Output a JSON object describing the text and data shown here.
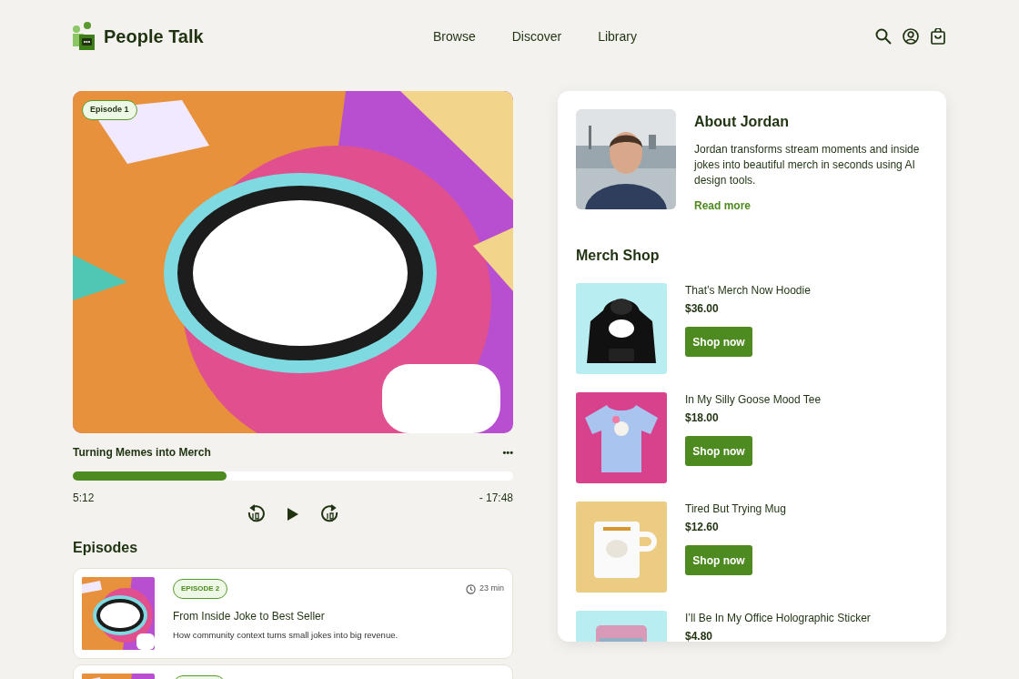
{
  "header": {
    "brand": "People Talk",
    "nav": [
      {
        "label": "Browse"
      },
      {
        "label": "Discover"
      },
      {
        "label": "Library"
      }
    ]
  },
  "player": {
    "badge": "Episode 1",
    "title": "Turning Memes into Merch",
    "menu": "•••",
    "level": 0.35,
    "elapsed": "5:12",
    "remaining": "- 17:48"
  },
  "episodes": {
    "heading": "Episodes",
    "items": [
      {
        "kind": "episode",
        "badge": "EPISODE 2",
        "duration": "23 min",
        "title": "From Inside Joke to Best Seller",
        "description": "How community context turns small jokes into big revenue."
      },
      {
        "kind": "episode"
      }
    ]
  },
  "about": {
    "heading": "About Jordan",
    "bio": "Jordan transforms stream moments and inside jokes into beautiful merch in seconds using AI design tools.",
    "link": "Read more"
  },
  "shop": {
    "heading": "Merch Shop",
    "items": [
      {
        "kind": "hoodie",
        "name": "That’s Merch Now Hoodie",
        "price": "$36.00",
        "button": "Shop now"
      },
      {
        "kind": "tee",
        "name": "In My Silly Goose Mood Tee",
        "price": "$18.00",
        "button": "Shop now"
      },
      {
        "kind": "mug",
        "name": "Tired But Trying Mug",
        "price": "$12.60",
        "button": "Shop now"
      },
      {
        "kind": "sticker",
        "name": "I’ll Be In My Office Holographic Sticker",
        "price": "$4.80"
      }
    ]
  }
}
